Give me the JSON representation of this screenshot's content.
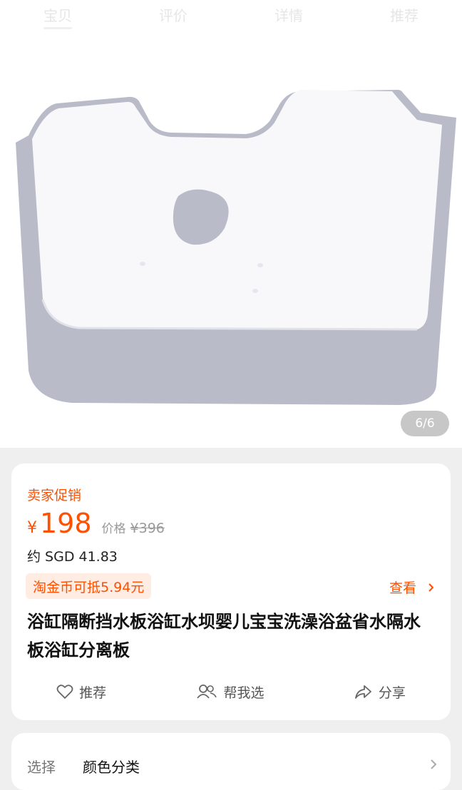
{
  "tabs": [
    "宝贝",
    "评价",
    "详情",
    "推荐"
  ],
  "image_counter": "6/6",
  "promo": {
    "label": "卖家促销",
    "currency": "¥",
    "price": "198",
    "original_label": "价格",
    "original_price": "¥396",
    "converted": "约 SGD 41.83"
  },
  "coin_offer": "淘金币可抵5.94元",
  "view_label": "查看",
  "product_title": "浴缸隔断挡水板浴缸水坝婴儿宝宝洗澡浴盆省水隔水板浴缸分离板",
  "actions": {
    "recommend": "推荐",
    "help_choose": "帮我选",
    "share": "分享"
  },
  "selection": {
    "label": "选择",
    "value": "颜色分类"
  },
  "colors": {
    "accent": "#ff5000",
    "product_body": "#b8bdc8",
    "product_panel": "#f7f7fb"
  }
}
